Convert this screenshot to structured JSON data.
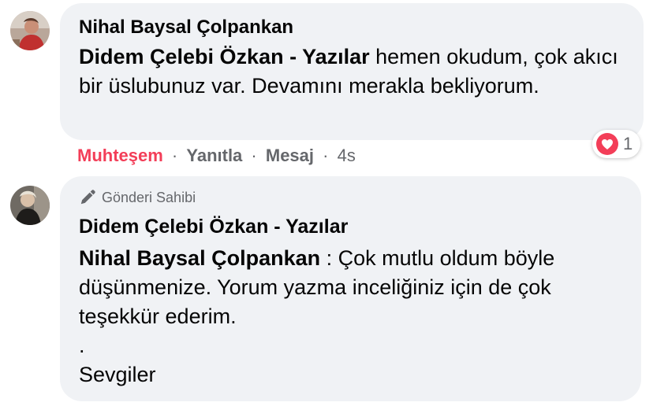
{
  "comments": [
    {
      "author": "Nihal Baysal Çolpankan",
      "mention": "Didem Çelebi Özkan - Yazılar",
      "text": " hemen okudum, çok akıcı bir üslubunuz var. Devamını merakla bekliyorum.",
      "actions": {
        "reaction": "Muhteşem",
        "reply": "Yanıtla",
        "message": "Mesaj",
        "separator": "·",
        "time": "4s"
      },
      "reaction_count": "1",
      "reaction_color": "#f33e58"
    },
    {
      "badge": "Gönderi Sahibi",
      "author": "Didem Çelebi Özkan - Yazılar",
      "mention": "Nihal Baysal Çolpankan",
      "text": " : Çok mutlu oldum böyle düşünmenize. Yorum yazma inceliğiniz için de çok teşekkür ederim.",
      "line2": ".",
      "line3": "Sevgiler"
    }
  ],
  "colors": {
    "bubble": "#f0f2f5",
    "secondary_text": "#65676b",
    "primary_text": "#050505"
  }
}
